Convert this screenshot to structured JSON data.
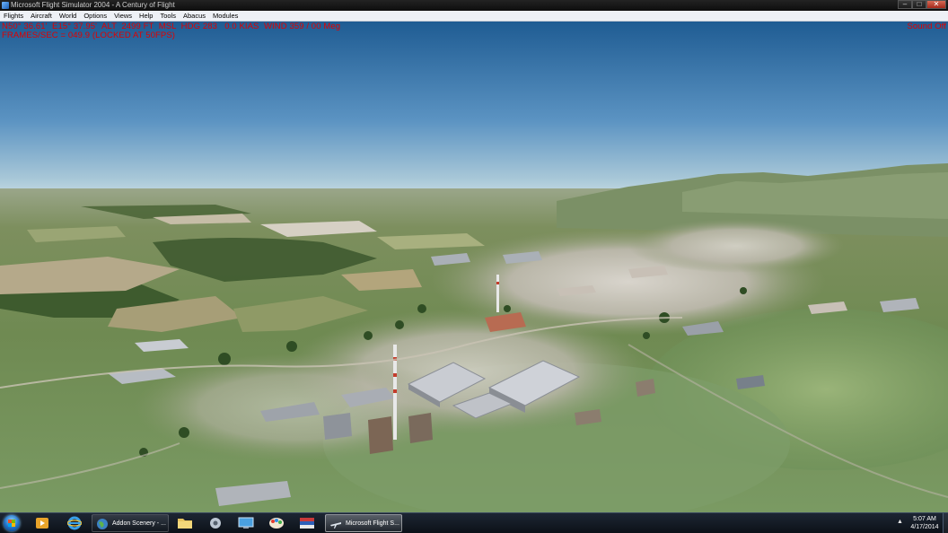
{
  "window": {
    "title": "Microsoft Flight Simulator 2004 - A Century of Flight",
    "minimize": "–",
    "maximize": "□",
    "close": "✕"
  },
  "menu": [
    "Flights",
    "Aircraft",
    "World",
    "Options",
    "Views",
    "Help",
    "Tools",
    "Abacus",
    "Modules"
  ],
  "hud": {
    "line1": "N50° 36.61'  E15° 37.95'  ALT  2499 FT  MSL  HDG 283   0.0 KIAS  WIND 359 / 00 Meg",
    "line2": "FRAMES/SEC = 049.9 (LOCKED AT 50FPS)",
    "sound": "Sound Off"
  },
  "colors": {
    "hud_text": "#e00000",
    "sky_top": "#1f5c93",
    "sky_horizon": "#cfe0e6",
    "terrain": "#6f8a52"
  },
  "taskbar": {
    "pinned_icons": [
      "start-orb",
      "media-player-icon",
      "internet-explorer-icon"
    ],
    "tasks": [
      {
        "label": "Addon Scenery - ...",
        "icon": "globe-icon",
        "active": false
      },
      {
        "label": "Microsoft Flight S...",
        "icon": "airplane-icon",
        "active": true
      }
    ],
    "extra_icons": [
      "folder-icon",
      "settings-tool-icon",
      "remote-desktop-icon",
      "paint-icon",
      "flag-app-icon"
    ],
    "tray_arrow": "▲",
    "time": "5:07 AM",
    "date": "4/17/2014"
  }
}
